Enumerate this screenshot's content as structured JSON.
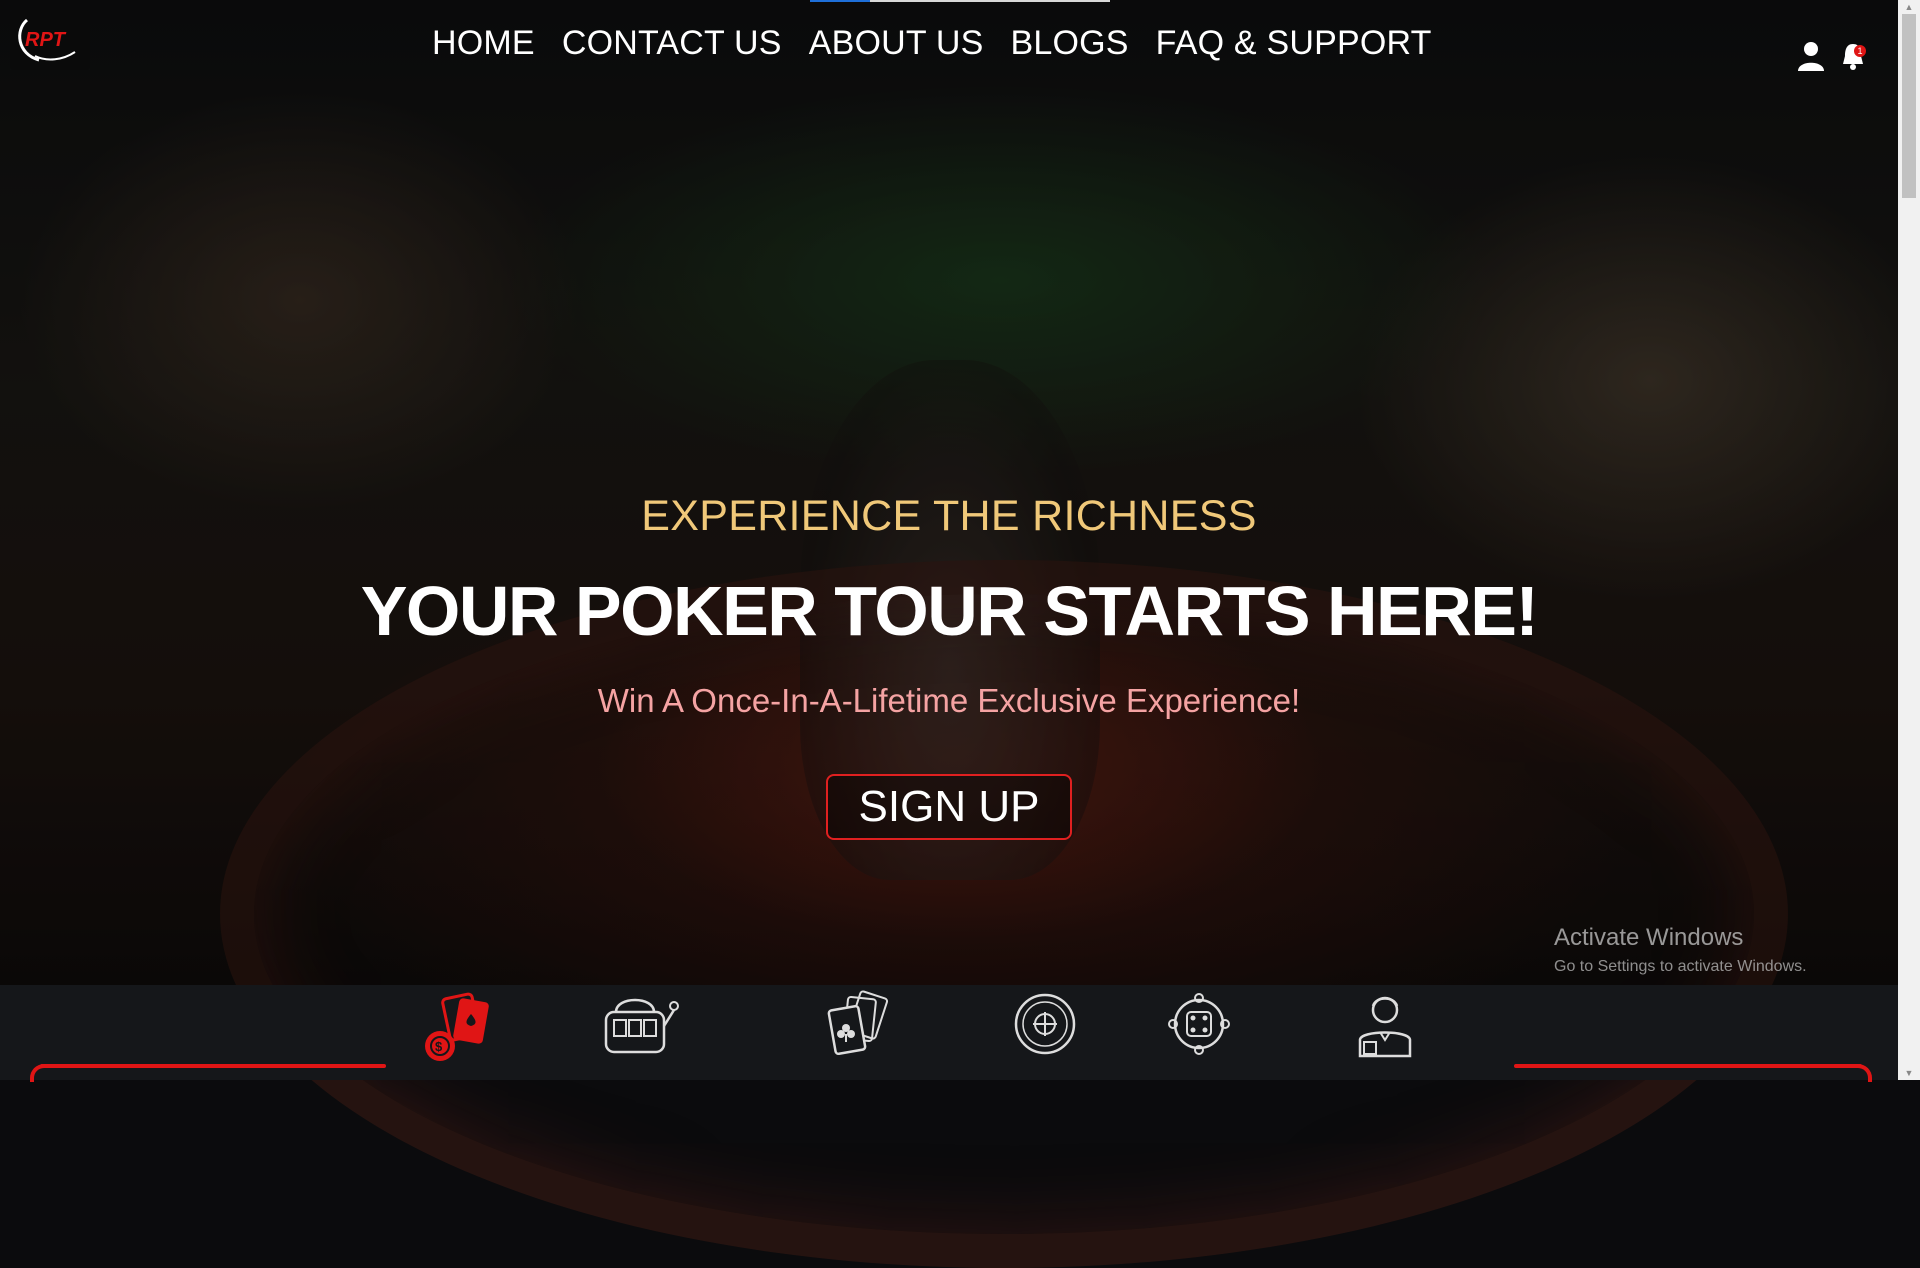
{
  "brand": {
    "logo_text": "RPT"
  },
  "nav": {
    "items": [
      {
        "label": "HOME"
      },
      {
        "label": "CONTACT US"
      },
      {
        "label": "ABOUT US"
      },
      {
        "label": "BLOGS"
      },
      {
        "label": "FAQ & SUPPORT"
      }
    ]
  },
  "header_icons": {
    "user": "user-icon",
    "bell": "bell-icon",
    "badge": "1"
  },
  "hero": {
    "eyebrow": "EXPERIENCE THE RICHNESS",
    "headline": "YOUR POKER TOUR STARTS HERE!",
    "subheadline": "Win A Once-In-A-Lifetime Exclusive Experience!",
    "cta_label": "SIGN UP"
  },
  "categories": [
    {
      "icon": "poker-chips-cards-icon",
      "active": true
    },
    {
      "icon": "slot-machine-icon",
      "active": false
    },
    {
      "icon": "playing-cards-icon",
      "active": false
    },
    {
      "icon": "roulette-icon",
      "active": false
    },
    {
      "icon": "dice-icon",
      "active": false
    },
    {
      "icon": "dealer-icon",
      "active": false
    }
  ],
  "os_watermark": {
    "title": "Activate Windows",
    "subtitle": "Go to Settings to activate Windows."
  },
  "colors": {
    "accent_red": "#e01515",
    "eyebrow_gold": "#f0c879",
    "sub_pink": "#f5a3a3"
  }
}
